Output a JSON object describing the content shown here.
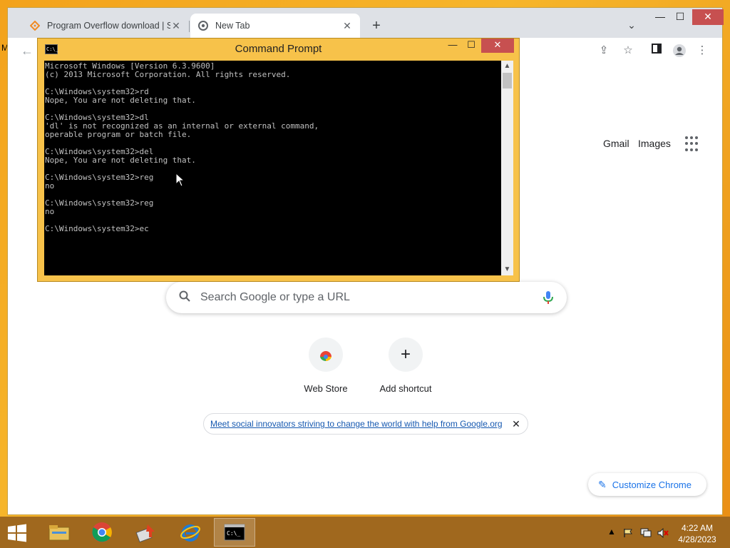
{
  "desktop": {
    "edge_label": "M"
  },
  "browser": {
    "tabs": [
      {
        "title": "Program Overflow download | Sc",
        "active": false
      },
      {
        "title": "New Tab",
        "active": true
      }
    ],
    "ntp": {
      "gmail": "Gmail",
      "images": "Images",
      "search_placeholder": "Search Google or type a URL",
      "shortcuts": [
        {
          "label": "Web Store"
        },
        {
          "label": "Add shortcut"
        }
      ],
      "promo_text": "Meet social innovators striving to change the world with help from Google.org",
      "customize": "Customize Chrome"
    }
  },
  "cmd": {
    "title": "Command Prompt",
    "icon_text": "C:\\_",
    "lines": [
      "Microsoft Windows [Version 6.3.9600]",
      "(c) 2013 Microsoft Corporation. All rights reserved.",
      "",
      "C:\\Windows\\system32>rd",
      "Nope, You are not deleting that.",
      "",
      "C:\\Windows\\system32>dl",
      "'dl' is not recognized as an internal or external command,",
      "operable program or batch file.",
      "",
      "C:\\Windows\\system32>del",
      "Nope, You are not deleting that.",
      "",
      "C:\\Windows\\system32>reg",
      "no",
      "",
      "C:\\Windows\\system32>reg",
      "no",
      "",
      "C:\\Windows\\system32>ec"
    ]
  },
  "taskbar": {
    "time": "4:22 AM",
    "date": "4/28/2023"
  },
  "colors": {
    "accent_blue": "#1a73e8",
    "close_red": "#c75050",
    "desktop_orange": "#f3a21b",
    "taskbar_brown": "#a0681e"
  }
}
